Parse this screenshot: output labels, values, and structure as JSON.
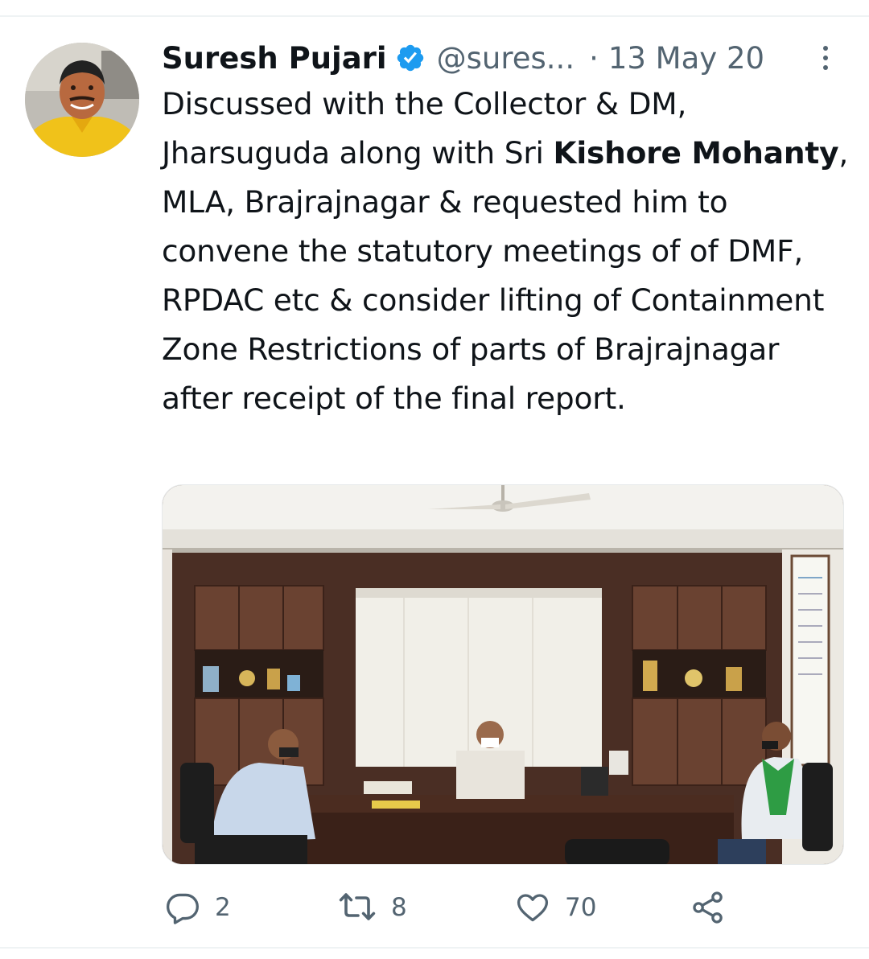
{
  "tweet": {
    "author": {
      "display_name": "Suresh Pujari",
      "handle": "@sures...",
      "verified": true
    },
    "separator": "·",
    "date": "13 May 20",
    "text": {
      "part1": "Discussed with the Collector & DM, Jharsuguda along with Sri ",
      "bold1": "Kishore Mohanty",
      "part2": ", MLA, Brajrajnagar & requested him to convene the statutory meetings of of DMF, RPDAC etc & consider lifting of Containment Zone Restrictions of parts of Brajrajnagar after receipt of the final report."
    },
    "actions": {
      "replies": "2",
      "retweets": "8",
      "likes": "70"
    }
  },
  "icons": {
    "verified": "verified-badge-icon",
    "more": "more-vertical-icon",
    "reply": "reply-icon",
    "retweet": "retweet-icon",
    "like": "heart-icon",
    "share": "share-icon"
  },
  "colors": {
    "verified_blue": "#1d9bf0",
    "secondary_text": "#536471",
    "primary_text": "#0f1419"
  }
}
